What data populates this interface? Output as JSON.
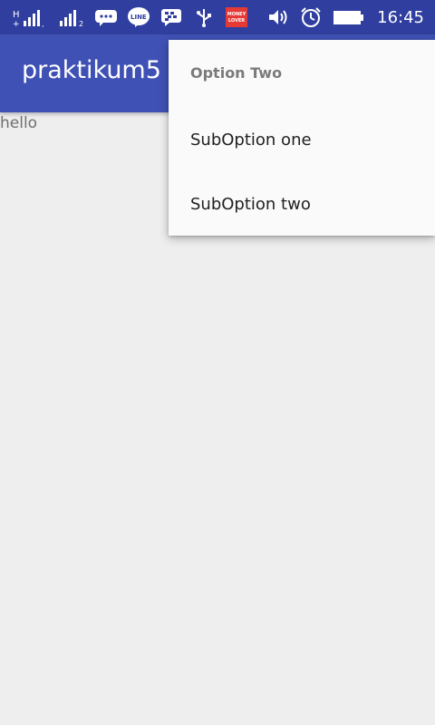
{
  "status_bar": {
    "time": "16:45",
    "icons": [
      "signal-icon",
      "signal-icon",
      "chat-bubble-icon",
      "line-app-icon",
      "bbm-icon",
      "usb-icon",
      "money-lover-icon",
      "volume-icon",
      "alarm-icon",
      "battery-icon"
    ],
    "money_lover_lettering": "MONEY LOVER"
  },
  "app_bar": {
    "title": "praktikum5"
  },
  "content": {
    "text": "hello"
  },
  "popup_menu": {
    "header": "Option Two",
    "items": [
      {
        "label": "SubOption one"
      },
      {
        "label": "SubOption two"
      }
    ]
  },
  "colors": {
    "status_bar": "#303f9f",
    "app_bar": "#3f51b5",
    "background": "#eeeeee",
    "menu_background": "#fafafa",
    "money_lover_badge": "#e53935"
  }
}
